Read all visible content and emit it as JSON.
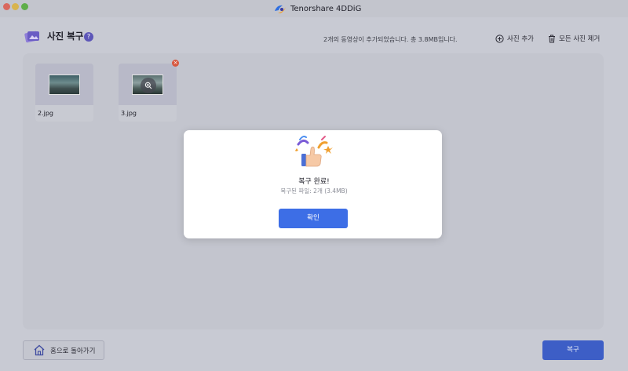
{
  "window": {
    "title": "Tenorshare 4DDiG",
    "traffic_lights": [
      "close",
      "minimize",
      "zoom"
    ]
  },
  "header": {
    "title": "사진 복구",
    "help_badge": "?",
    "status": "2개의 동영상이 추가되었습니다. 총 3.8MB입니다.",
    "add_photo_label": "사진 추가",
    "remove_all_label": "모든 사진 제거"
  },
  "photos": [
    {
      "name": "2.jpg"
    },
    {
      "name": "3.jpg"
    }
  ],
  "modal": {
    "title": "복구 완료!",
    "subtitle": "복구된 파일: 2개 (3.4MB)",
    "confirm_label": "확인"
  },
  "footer": {
    "home_label": "홈으로 돌아가기",
    "recover_label": "복구"
  },
  "colors": {
    "accent": "#3d6ee6",
    "overlay_bg": "#c8cad3",
    "delete_badge": "#d7583f"
  },
  "icons": {
    "app_logo": "4ddig-logo-icon",
    "header": "photo-recovery-icon",
    "add": "plus-circle-icon",
    "trash": "trash-icon",
    "zoom": "zoom-in-icon",
    "close": "close-icon",
    "celebrate": "thumbs-up-icon",
    "home": "home-icon"
  }
}
